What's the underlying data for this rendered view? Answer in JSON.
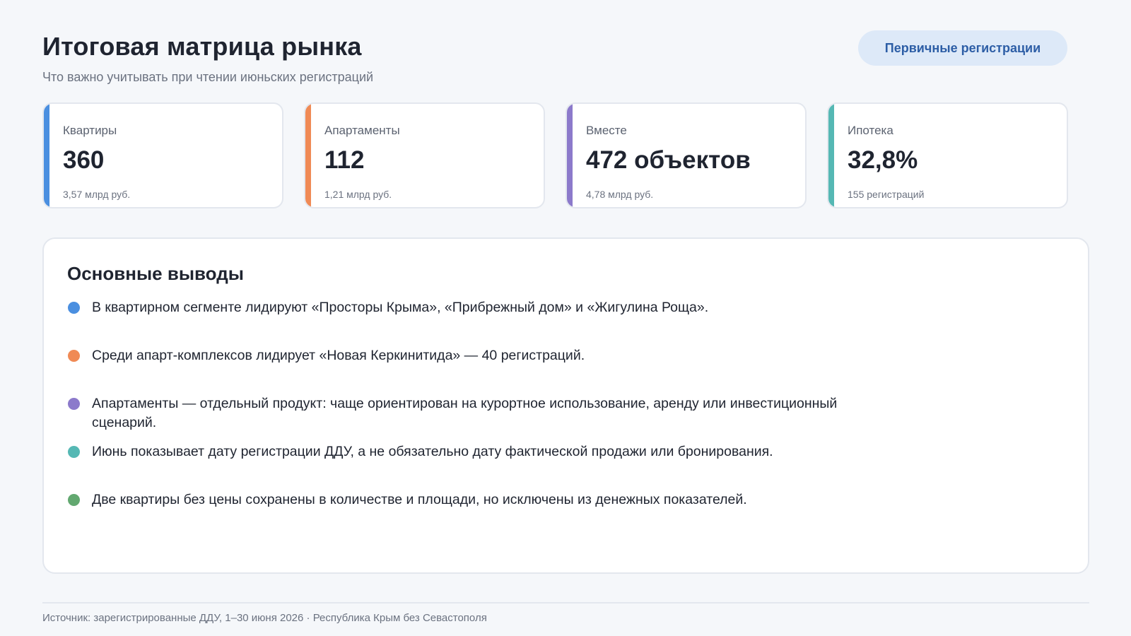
{
  "header": {
    "title": "Итоговая матрица рынка",
    "subtitle": "Что важно учитывать при чтении июньских регистраций",
    "badge": "Первичные регистрации"
  },
  "kpis": [
    {
      "label": "Квартиры",
      "value": "360",
      "note": "3,57 млрд руб.",
      "color": "#4a8fe0"
    },
    {
      "label": "Апартаменты",
      "value": "112",
      "note": "1,21 млрд руб.",
      "color": "#f08a55"
    },
    {
      "label": "Вместе",
      "value": "472 объектов",
      "note": "4,78 млрд руб.",
      "color": "#8c7acb"
    },
    {
      "label": "Ипотека",
      "value": "32,8%",
      "note": "155 регистраций",
      "color": "#55b8b4"
    }
  ],
  "conclusions": {
    "title": "Основные выводы",
    "items": [
      {
        "text": "В квартирном сегменте лидируют «Просторы Крыма», «Прибрежный дом» и «Жигулина Роща».",
        "color": "#4a8fe0"
      },
      {
        "text": "Среди апарт-комплексов лидирует «Новая Керкинитида» — 40 регистраций.",
        "color": "#f08a55"
      },
      {
        "text": "Апартаменты — отдельный продукт: чаще ориентирован на курортное использование, аренду или инвестиционный сценарий.",
        "color": "#8c7acb"
      },
      {
        "text": "Июнь показывает дату регистрации ДДУ, а не обязательно дату фактической продажи или бронирования.",
        "color": "#55b8b4"
      },
      {
        "text": "Две квартиры без цены сохранены в количестве и площади, но исключены из денежных показателей.",
        "color": "#62a870"
      }
    ]
  },
  "footer": {
    "source": "Источник: зарегистрированные ДДУ, 1–30 июня 2026 · Республика Крым без Севастополя"
  }
}
